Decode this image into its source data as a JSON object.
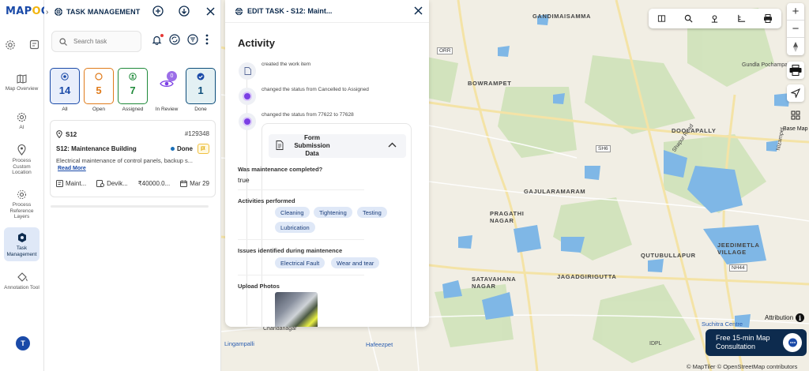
{
  "brand": {
    "logo_pre": "MAP",
    "logo_mid": "O",
    "logo_post": "G",
    "accent": "#1a4aa8",
    "navy": "#0d2b4e"
  },
  "leftnav": {
    "items": [
      {
        "label": "Map Overview"
      },
      {
        "label": "AI"
      },
      {
        "label": "Process Custom Location"
      },
      {
        "label": "Process Reference Layers"
      },
      {
        "label": "Task Management",
        "active": true
      },
      {
        "label": "Annotation Tool"
      }
    ],
    "avatar": "T"
  },
  "taskpanel": {
    "title": "TASK MANAGEMENT",
    "search_placeholder": "Search task",
    "stats": [
      {
        "label": "All",
        "count": "14",
        "color": "#1a4aa8"
      },
      {
        "label": "Open",
        "count": "5",
        "color": "#e07b1a"
      },
      {
        "label": "Assigned",
        "count": "7",
        "color": "#1f8a3a"
      },
      {
        "label": "In Review",
        "count": "0",
        "color": "#7b3fe4"
      },
      {
        "label": "Done",
        "count": "1",
        "color": "#0d4d7a"
      }
    ],
    "card": {
      "location": "S12",
      "id": "#129348",
      "title": "S12: Maintenance Building",
      "status": "Done",
      "description": "Electrical maintenance of control panels, backup s...",
      "read_more": "Read More",
      "type": "Maint...",
      "assignee": "Devik...",
      "amount": "₹40000.0...",
      "date": "Mar 29"
    }
  },
  "editpanel": {
    "title": "EDIT TASK - S12: Maint...",
    "activity_title": "Activity",
    "activities": [
      "created the work item",
      "changed the status from Cancelled to Assigned",
      "changed the status from 77622 to 77628"
    ],
    "form": {
      "title": "Form Submission Data",
      "q1": "Was maintenance completed?",
      "a1": "true",
      "q2": "Activities performed",
      "a2": [
        "Cleaning",
        "Tightening",
        "Testing",
        "Lubrication"
      ],
      "q3": "Issues identified during maintenence",
      "a3": [
        "Electrical Fault",
        "Wear and tear"
      ],
      "q4": "Upload Photos"
    }
  },
  "map": {
    "labels": {
      "gandimaisamma": "GANDIMAISAMMA",
      "bowrampet": "BOWRAMPET",
      "gundla": "Gundla Pochampally",
      "doolapally": "DOOLAPALLY",
      "gajularamaram": "GAJULARAMARAM",
      "pragathi": "PRAGATHI NAGAR",
      "jeedimetla": "JEEDIMETLA VILLAGE",
      "qutbullapur": "QUTUBULLAPUR",
      "satavahana": "SATAVAHANA NAGAR",
      "jagadgiri": "JAGADGIRIGUTTA",
      "chandanagar": "Chandanagar",
      "lingampalli": "Lingampalli",
      "hafeezpet": "Hafeezpet",
      "suchitra": "Suchitra Centre",
      "idpl": "IDPL",
      "orr": "ORR",
      "sh6": "SH6",
      "nh44": "NH44",
      "shapur": "Shapur Road",
      "nizampet": "Nizampet"
    },
    "base_map_label": "Base Map",
    "attribution": "Attribution",
    "credit": "© MapTiler © OpenStreetMap contributors",
    "consult": "Free 15-min Map Consultation"
  }
}
